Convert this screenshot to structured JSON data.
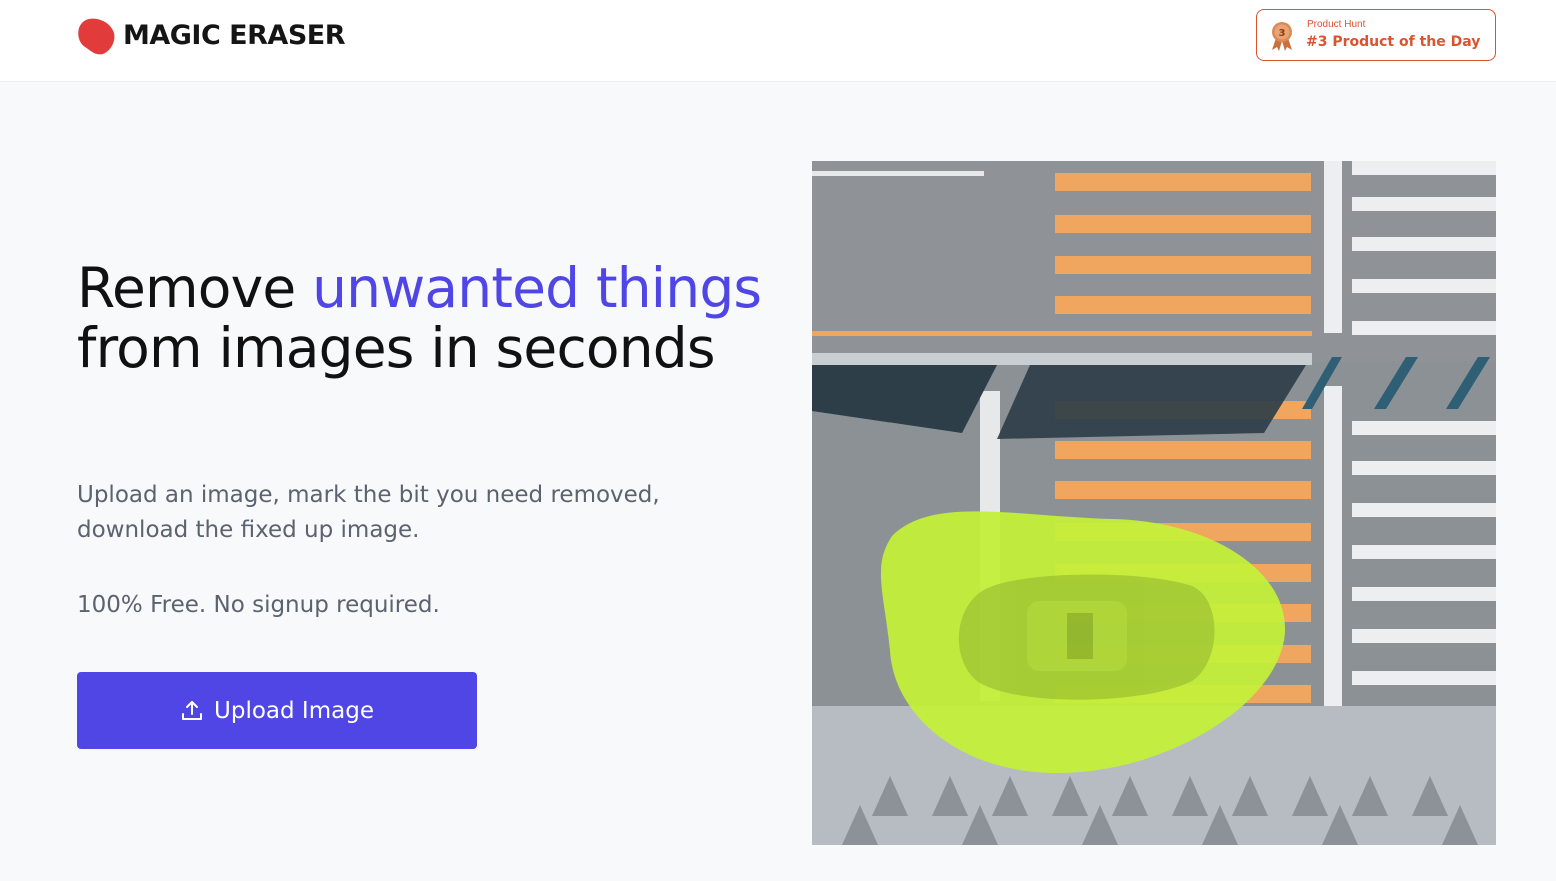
{
  "header": {
    "logo_text": "MAGIC ERASER",
    "badge": {
      "small_label": "Product Hunt",
      "main_label": "#3 Product of the Day",
      "medal_number": "3",
      "icon": "medal-icon"
    }
  },
  "hero": {
    "title_part1": "Remove ",
    "title_highlight": "unwanted things",
    "title_part2": " from images in seconds",
    "subtitle": "Upload an image, mark the bit you need removed, download the fixed up image.",
    "free_note": "100% Free. No signup required.",
    "upload_label": "Upload Image",
    "upload_icon": "upload-icon"
  },
  "colors": {
    "accent": "#4f46e5",
    "logo_red": "#e23b3b",
    "badge_orange": "#da552f",
    "mask_green": "#c4ef3a"
  }
}
